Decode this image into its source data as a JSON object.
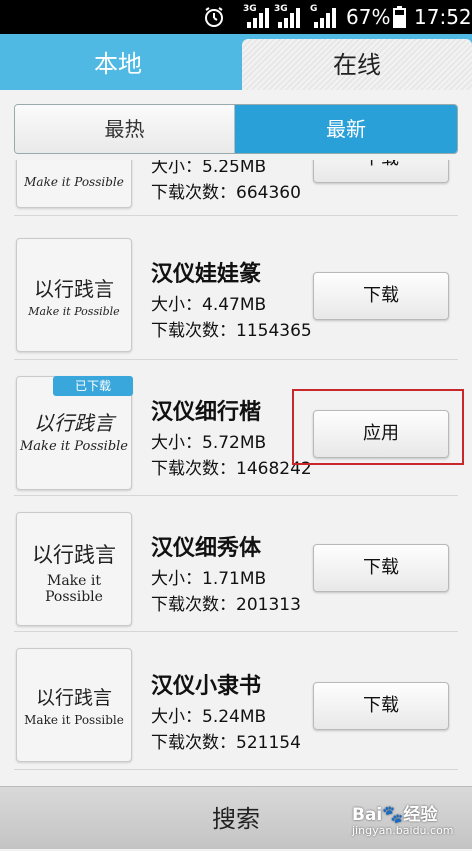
{
  "status": {
    "alarm_icon": "alarm-clock-icon",
    "net1": "3G",
    "net2": "3G",
    "net3": "G",
    "battery": "67%",
    "time": "17:52"
  },
  "tabs": {
    "local": "本地",
    "online": "在线"
  },
  "segment": {
    "hot": "最热",
    "new": "最新"
  },
  "thumb_text": {
    "line1": "以行践言",
    "line2": "Make it Possible"
  },
  "fonts": [
    {
      "name": "",
      "size": "大小：5.25MB",
      "downloads": "下载次数：664360",
      "button": "下载",
      "badge": ""
    },
    {
      "name": "汉仪娃娃篆",
      "size": "大小：4.47MB",
      "downloads": "下载次数：1154365",
      "button": "下载",
      "badge": ""
    },
    {
      "name": "汉仪细行楷",
      "size": "大小：5.72MB",
      "downloads": "下载次数：1468242",
      "button": "应用",
      "badge": "已下载"
    },
    {
      "name": "汉仪细秀体",
      "size": "大小：1.71MB",
      "downloads": "下载次数：201313",
      "button": "下载",
      "badge": ""
    },
    {
      "name": "汉仪小隶书",
      "size": "大小：5.24MB",
      "downloads": "下载次数：521154",
      "button": "下载",
      "badge": ""
    }
  ],
  "bottom": {
    "search": "搜索"
  },
  "watermark": {
    "brand": "Bai🐾经验",
    "url": "jingyan.baidu.com"
  },
  "colors": {
    "accent": "#4fb9e3",
    "segment_active": "#2aa0d8",
    "highlight": "#c8282a"
  }
}
